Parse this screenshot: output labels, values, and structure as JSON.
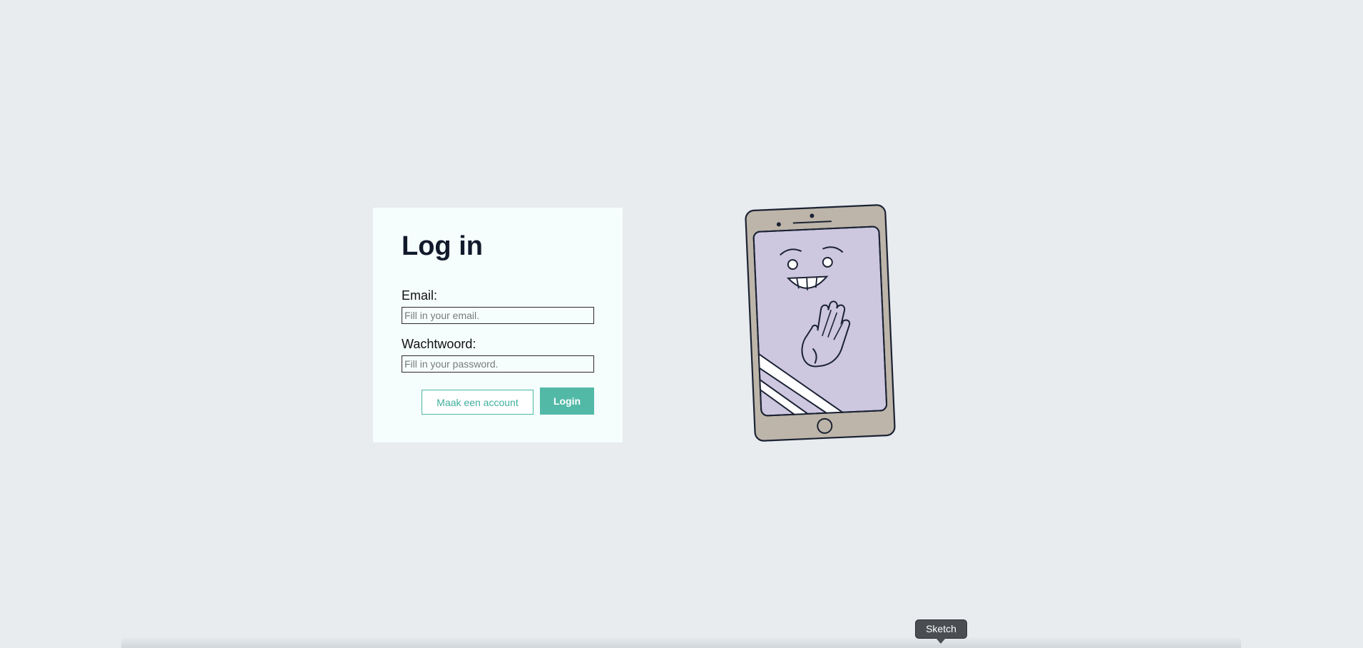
{
  "login": {
    "title": "Log in",
    "email_label": "Email:",
    "email_placeholder": "Fill in your email.",
    "email_value": "",
    "password_label": "Wachtwoord:",
    "password_placeholder": "Fill in your password.",
    "password_value": "",
    "create_account_label": "Maak een account",
    "login_button_label": "Login"
  },
  "illustration": {
    "icon": "waving-phone-illustration"
  },
  "dock": {
    "tooltip": "Sketch"
  },
  "colors": {
    "page_background": "#e8ecef",
    "card_background": "#f5fdfd",
    "accent": "#52b9a7",
    "title": "#111a2b",
    "phone_body": "#bdb5a9",
    "phone_screen": "#cdc7e0"
  }
}
